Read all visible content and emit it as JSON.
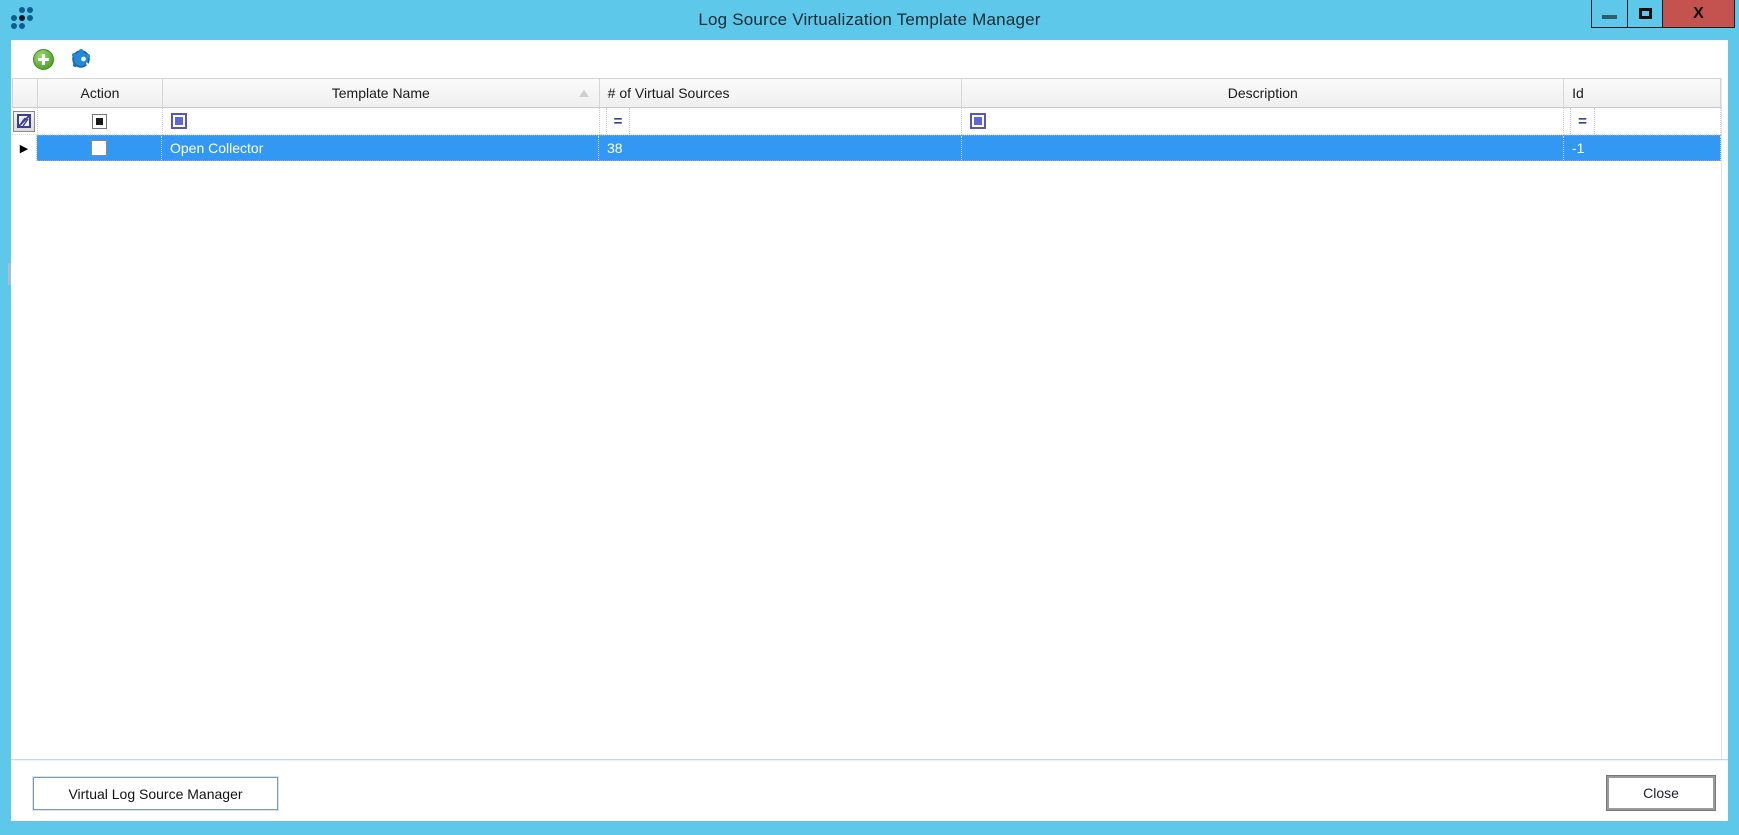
{
  "window": {
    "title": "Log Source Virtualization Template Manager",
    "close_glyph": "X"
  },
  "icons": {
    "row_arrow": "▶",
    "equals_operator": "=",
    "add_icon_shape": "green-circle-plus",
    "gear_icon_shape": "blue-gear",
    "sort_ascending": "triangle-up"
  },
  "grid": {
    "columns": [
      {
        "label": "Action"
      },
      {
        "label": "Template Name",
        "sorted": "ascending"
      },
      {
        "label": "# of Virtual Sources"
      },
      {
        "label": "Description"
      },
      {
        "label": "Id"
      }
    ],
    "filter_row": {
      "action_filter_state": "indeterminate",
      "template_name_filter_state": "indeterminate",
      "num_sources_operator": "=",
      "description_filter_state": "indeterminate",
      "id_operator": "="
    },
    "rows": [
      {
        "selected": true,
        "action_checked": false,
        "template_name": "Open Collector",
        "num_virtual_sources": "38",
        "description": "",
        "id": "-1"
      }
    ]
  },
  "footer": {
    "manager_button": "Virtual Log Source Manager",
    "close_button": "Close"
  },
  "colors": {
    "titlebar": "#5ec8ea",
    "selection_row": "#3398f4",
    "close_button": "#c4524e",
    "add_green": "#58a733",
    "gear_blue": "#2487d8",
    "filter_accent": "#6366d6"
  }
}
